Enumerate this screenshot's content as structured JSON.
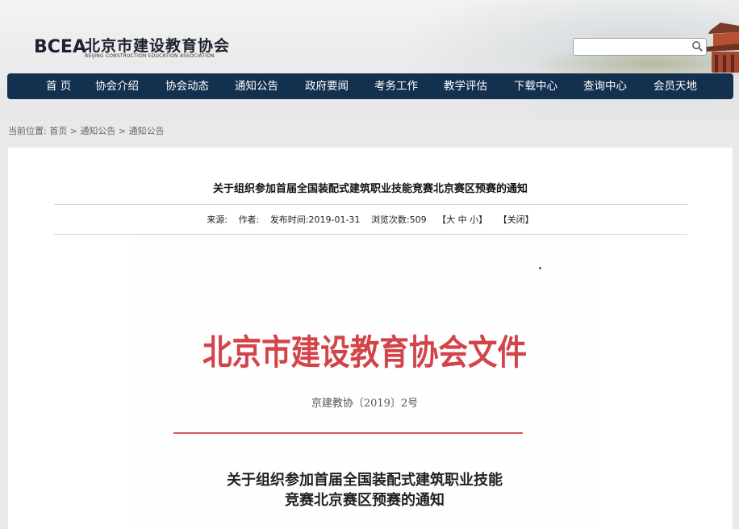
{
  "header": {
    "logo_mark": "BCEA",
    "logo_cn": "北京市建设教育协会",
    "logo_en": "BEIJING CONSTRUCTION EDUCATION ASSOCIATION",
    "search_placeholder": ""
  },
  "nav": {
    "items": [
      "首 页",
      "协会介绍",
      "协会动态",
      "通知公告",
      "政府要闻",
      "考务工作",
      "教学评估",
      "下载中心",
      "查询中心",
      "会员天地"
    ]
  },
  "breadcrumb": {
    "prefix": "当前位置:",
    "home": "首页",
    "sep": " > ",
    "level1": "通知公告",
    "level2": "通知公告"
  },
  "article": {
    "title": "关于组织参加首届全国装配式建筑职业技能竞赛北京赛区预赛的通知",
    "source_label": "来源:",
    "author_label": "作者:",
    "publish_label": "发布时间:",
    "publish_date": "2019-01-31",
    "views_label": "浏览次数:",
    "views": "509",
    "font_size_ctrl": "【大 中 小】",
    "close_ctrl": "【关闭】"
  },
  "document": {
    "heading": "北京市建设教育协会文件",
    "doc_number": "京建教协〔2019〕2号",
    "title_line1": "关于组织参加首届全国装配式建筑职业技能",
    "title_line2": "竞赛北京赛区预赛的通知"
  },
  "colors": {
    "nav_bg": "#14304f",
    "doc_red": "#d3444a"
  }
}
